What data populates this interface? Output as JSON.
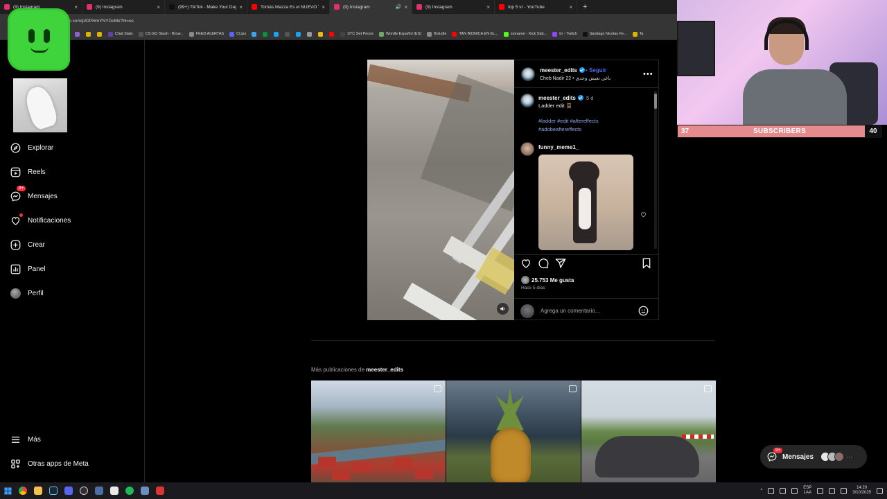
{
  "browser": {
    "tabs": [
      {
        "title": "(9) Instagram",
        "color": "#e1306c",
        "active": false
      },
      {
        "title": "(9) Instagram",
        "color": "#e1306c",
        "active": false
      },
      {
        "title": "(99+) TikTok - Make Your Day",
        "color": "#111111",
        "active": false
      },
      {
        "title": "Tomás Mazza Es el NUEVO Ya...",
        "color": "#ff0000",
        "active": false
      },
      {
        "title": "(9) Instagram",
        "color": "#e1306c",
        "active": true
      },
      {
        "title": "(9) Instagram",
        "color": "#e1306c",
        "active": false
      },
      {
        "title": "top 5 vr - YouTube",
        "color": "#ff0000",
        "active": false
      }
    ],
    "url": "gram.com/p/DPHmYNYDoMi/?hl=es",
    "bookmarks": [
      {
        "label": "",
        "color": "#8a63d2"
      },
      {
        "label": "",
        "color": "#e0b200"
      },
      {
        "label": "",
        "color": "#e0b200"
      },
      {
        "label": "Chat Stats",
        "color": "#6441a5"
      },
      {
        "label": "CS:GO Stash - Brow...",
        "color": "#555555"
      },
      {
        "label": "FEED ALERTAS",
        "color": "#888888"
      },
      {
        "label": "CLips",
        "color": "#5865f2"
      },
      {
        "label": "",
        "color": "#3aa6f0"
      },
      {
        "label": "",
        "color": "#0a8f3c"
      },
      {
        "label": "",
        "color": "#1da1f2"
      },
      {
        "label": "",
        "color": "#555555"
      },
      {
        "label": "",
        "color": "#1da1f2"
      },
      {
        "label": "",
        "color": "#999999"
      },
      {
        "label": "",
        "color": "#f0b90b"
      },
      {
        "label": "",
        "color": "#ff0000"
      },
      {
        "label": "STC Set Prices",
        "color": "#444444"
      },
      {
        "label": "Wordle Español (ES)",
        "color": "#6aaa64"
      },
      {
        "label": "Boludle",
        "color": "#888888"
      },
      {
        "label": "TAN BIONICA EN EL...",
        "color": "#ff0000"
      },
      {
        "label": "sionaron - Kick Stat...",
        "color": "#53fc18"
      },
      {
        "label": "trr - Twitch",
        "color": "#9146ff"
      },
      {
        "label": "Santiago Nicolas Fe...",
        "color": "#111111"
      },
      {
        "label": "Ta",
        "color": "#e0b200"
      }
    ]
  },
  "stream": {
    "subs_current": "37",
    "subs_label": "SUBSCRIBERS",
    "subs_goal": "40"
  },
  "sidebar": {
    "items": [
      {
        "label": "Explorar",
        "icon": "compass-icon"
      },
      {
        "label": "Reels",
        "icon": "reels-icon"
      },
      {
        "label": "Mensajes",
        "icon": "messenger-icon",
        "badge": "9+"
      },
      {
        "label": "Notificaciones",
        "icon": "heart-icon"
      },
      {
        "label": "Crear",
        "icon": "plus-square-icon"
      },
      {
        "label": "Panel",
        "icon": "dashboard-icon"
      },
      {
        "label": "Perfil",
        "icon": "profile-avatar"
      }
    ],
    "bottom": [
      {
        "label": "Más",
        "icon": "hamburger-icon"
      },
      {
        "label": "Otras apps de Meta",
        "icon": "meta-apps-icon"
      }
    ]
  },
  "post": {
    "author": "meester_edits",
    "follow_label": "Seguir",
    "audio": "Cheb Nadir 22 • باغي نعيش وحدي",
    "caption_author": "meester_edits",
    "caption_time": "5 d",
    "caption_text": "Ladder edit 🪜",
    "hashtags_line1": "#ladder #edit #aftereffects",
    "hashtags_line2": "#adobeaftereffects",
    "commenter": "funny_meme1_",
    "likes": "25.753 Me gusta",
    "posted_ago": "Hace 5 días",
    "comment_placeholder": "Agrega un comentario..."
  },
  "more": {
    "prefix": "Más publicaciones de ",
    "author": "meester_edits"
  },
  "messages_pill": {
    "label": "Mensajes",
    "badge": "9+"
  },
  "tray": {
    "lang": "ESP",
    "layout": "LAA",
    "time": "14:20",
    "date": "3/10/2025"
  }
}
